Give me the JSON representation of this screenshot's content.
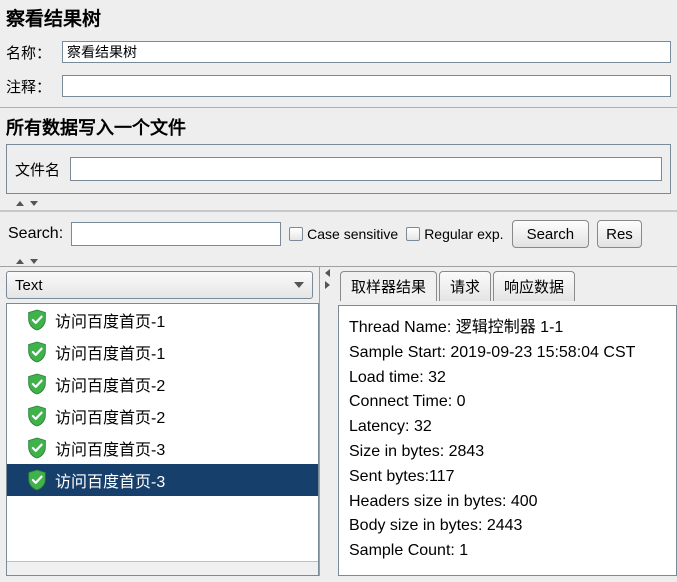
{
  "title": "察看结果树",
  "labels": {
    "name": "名称：",
    "comment": "注释：",
    "writeAllDataHeading": "所有数据写入一个文件",
    "filename": "文件名",
    "search": "Search:",
    "caseSensitive": "Case sensitive",
    "regularExp": "Regular exp.",
    "searchBtn": "Search",
    "resetBtn": "Res"
  },
  "fields": {
    "nameValue": "察看结果树",
    "commentValue": "",
    "filenameValue": "",
    "searchValue": ""
  },
  "renderer": {
    "selected": "Text"
  },
  "tree": {
    "items": [
      {
        "label": "访问百度首页-1",
        "selected": false
      },
      {
        "label": "访问百度首页-1",
        "selected": false
      },
      {
        "label": "访问百度首页-2",
        "selected": false
      },
      {
        "label": "访问百度首页-2",
        "selected": false
      },
      {
        "label": "访问百度首页-3",
        "selected": false
      },
      {
        "label": "访问百度首页-3",
        "selected": true
      }
    ]
  },
  "tabs": [
    {
      "label": "取样器结果",
      "active": true
    },
    {
      "label": "请求",
      "active": false
    },
    {
      "label": "响应数据",
      "active": false
    }
  ],
  "details": [
    {
      "k": "Thread Name: ",
      "v": "逻辑控制器 1-1"
    },
    {
      "k": "Sample Start: ",
      "v": "2019-09-23 15:58:04 CST"
    },
    {
      "k": "Load time: ",
      "v": "32"
    },
    {
      "k": "Connect Time: ",
      "v": "0"
    },
    {
      "k": "Latency: ",
      "v": "32"
    },
    {
      "k": "Size in bytes: ",
      "v": "2843"
    },
    {
      "k": "Sent bytes:",
      "v": "117"
    },
    {
      "k": "Headers size in bytes: ",
      "v": "400"
    },
    {
      "k": "Body size in bytes: ",
      "v": "2443"
    },
    {
      "k": "Sample Count: ",
      "v": "1"
    }
  ],
  "colors": {
    "selection": "#163f6b",
    "shield": "#3fb24c"
  }
}
